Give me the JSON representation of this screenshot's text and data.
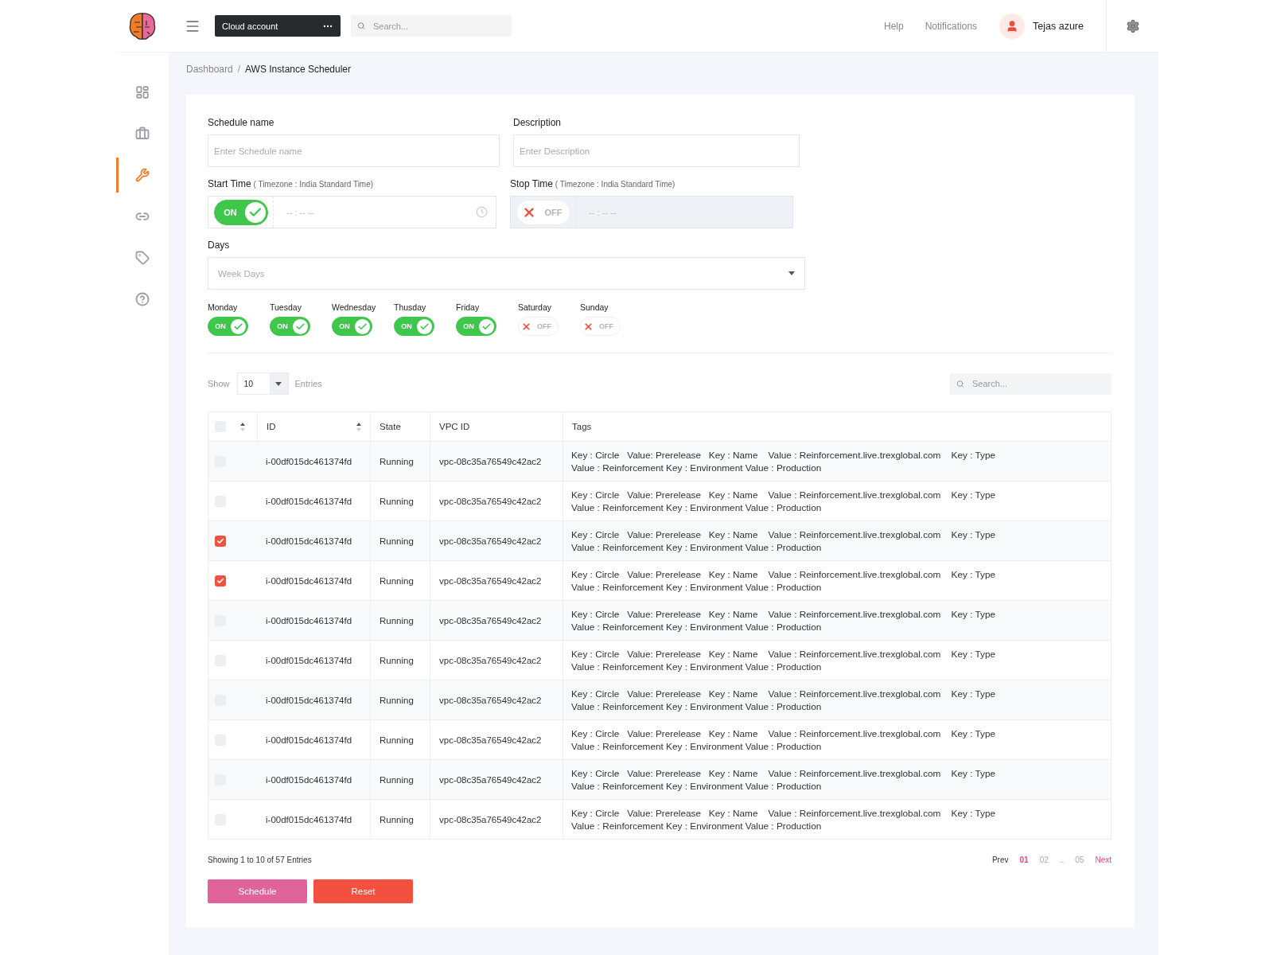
{
  "header": {
    "account": "Cloud account",
    "search_placeholder": "Search...",
    "links": [
      "Help",
      "Notifications"
    ],
    "user": "Tejas azure"
  },
  "sidebar": {
    "items": [
      {
        "kind": "dashboard",
        "selected": false
      },
      {
        "kind": "briefcase",
        "selected": false
      },
      {
        "kind": "tools",
        "selected": true
      },
      {
        "kind": "link",
        "selected": false
      },
      {
        "kind": "tag",
        "selected": false
      },
      {
        "kind": "help",
        "selected": false
      }
    ]
  },
  "breadcrumb": {
    "separator": "/",
    "items": [
      "Dashboard",
      "AWS Instance Scheduler"
    ]
  },
  "form": {
    "schedule_name": {
      "label": "Schedule name",
      "placeholder": "Enter Schedule name"
    },
    "description": {
      "label": "Description",
      "placeholder": "Enter Description"
    },
    "start_time": {
      "label": "Start Time",
      "note": "( Timezone : India Standard Time)",
      "on": true,
      "toggle_label": "ON",
      "placeholder": "-- : -- --"
    },
    "stop_time": {
      "label": "Stop Time",
      "note": "( Timezone : India Standard Time)",
      "on": false,
      "toggle_label": "OFF",
      "placeholder": "-- : -- --"
    },
    "days": {
      "label": "Days",
      "placeholder": "Week Days"
    },
    "weekdays": [
      {
        "name": "Monday",
        "on": true,
        "toggle_label": "ON"
      },
      {
        "name": "Tuesday",
        "on": true,
        "toggle_label": "ON"
      },
      {
        "name": "Wednesday",
        "on": true,
        "toggle_label": "ON"
      },
      {
        "name": "Thusday",
        "on": true,
        "toggle_label": "ON"
      },
      {
        "name": "Friday",
        "on": true,
        "toggle_label": "ON"
      },
      {
        "name": "Saturday",
        "on": false,
        "toggle_label": "OFF"
      },
      {
        "name": "Sunday",
        "on": false,
        "toggle_label": "OFF"
      }
    ]
  },
  "table": {
    "show_label": "Show",
    "page_size": "10",
    "entries_label": "Entries",
    "search_placeholder": "Search...",
    "header_checked": false,
    "columns": [
      "ID",
      "State",
      "VPC ID",
      "Tags"
    ],
    "rows": [
      {
        "checked": false,
        "id": "i-00df015dc461374fd",
        "state": "Running",
        "vpc_id": "vpc-08c35a76549c42ac2",
        "tags": "Key : Circle   Value: Prerelease   Key : Name    Value : Reinforcement.live.trexglobal.com    Key : Type Value : Reinforcement Key : Environment Value : Production"
      },
      {
        "checked": false,
        "id": "i-00df015dc461374fd",
        "state": "Running",
        "vpc_id": "vpc-08c35a76549c42ac2",
        "tags": "Key : Circle   Value: Prerelease   Key : Name    Value : Reinforcement.live.trexglobal.com    Key : Type Value : Reinforcement Key : Environment Value : Production"
      },
      {
        "checked": true,
        "id": "i-00df015dc461374fd",
        "state": "Running",
        "vpc_id": "vpc-08c35a76549c42ac2",
        "tags": "Key : Circle   Value: Prerelease   Key : Name    Value : Reinforcement.live.trexglobal.com    Key : Type Value : Reinforcement Key : Environment Value : Production"
      },
      {
        "checked": true,
        "id": "i-00df015dc461374fd",
        "state": "Running",
        "vpc_id": "vpc-08c35a76549c42ac2",
        "tags": "Key : Circle   Value: Prerelease   Key : Name    Value : Reinforcement.live.trexglobal.com    Key : Type Value : Reinforcement Key : Environment Value : Production"
      },
      {
        "checked": false,
        "id": "i-00df015dc461374fd",
        "state": "Running",
        "vpc_id": "vpc-08c35a76549c42ac2",
        "tags": "Key : Circle   Value: Prerelease   Key : Name    Value : Reinforcement.live.trexglobal.com    Key : Type Value : Reinforcement Key : Environment Value : Production"
      },
      {
        "checked": false,
        "id": "i-00df015dc461374fd",
        "state": "Running",
        "vpc_id": "vpc-08c35a76549c42ac2",
        "tags": "Key : Circle   Value: Prerelease   Key : Name    Value : Reinforcement.live.trexglobal.com    Key : Type Value : Reinforcement Key : Environment Value : Production"
      },
      {
        "checked": false,
        "id": "i-00df015dc461374fd",
        "state": "Running",
        "vpc_id": "vpc-08c35a76549c42ac2",
        "tags": "Key : Circle   Value: Prerelease   Key : Name    Value : Reinforcement.live.trexglobal.com    Key : Type Value : Reinforcement Key : Environment Value : Production"
      },
      {
        "checked": false,
        "id": "i-00df015dc461374fd",
        "state": "Running",
        "vpc_id": "vpc-08c35a76549c42ac2",
        "tags": "Key : Circle   Value: Prerelease   Key : Name    Value : Reinforcement.live.trexglobal.com    Key : Type Value : Reinforcement Key : Environment Value : Production"
      },
      {
        "checked": false,
        "id": "i-00df015dc461374fd",
        "state": "Running",
        "vpc_id": "vpc-08c35a76549c42ac2",
        "tags": "Key : Circle   Value: Prerelease   Key : Name    Value : Reinforcement.live.trexglobal.com    Key : Type Value : Reinforcement Key : Environment Value : Production"
      },
      {
        "checked": false,
        "id": "i-00df015dc461374fd",
        "state": "Running",
        "vpc_id": "vpc-08c35a76549c42ac2",
        "tags": "Key : Circle   Value: Prerelease   Key : Name    Value : Reinforcement.live.trexglobal.com    Key : Type Value : Reinforcement Key : Environment Value : Production"
      }
    ],
    "footer": "Showing 1 to 10 of 57 Entries",
    "pagination": [
      {
        "kind": "prev",
        "label": "Prev",
        "selected": false
      },
      {
        "kind": "page",
        "label": "01",
        "selected": true
      },
      {
        "kind": "page",
        "label": "02",
        "selected": false
      },
      {
        "kind": "ellipsis",
        "label": "..",
        "selected": false
      },
      {
        "kind": "page",
        "label": "05",
        "selected": false
      },
      {
        "kind": "next",
        "label": "Next",
        "selected": false
      }
    ]
  },
  "buttons": [
    {
      "kind": "primary",
      "label": "Schedule"
    },
    {
      "kind": "danger",
      "label": "Reset"
    }
  ]
}
